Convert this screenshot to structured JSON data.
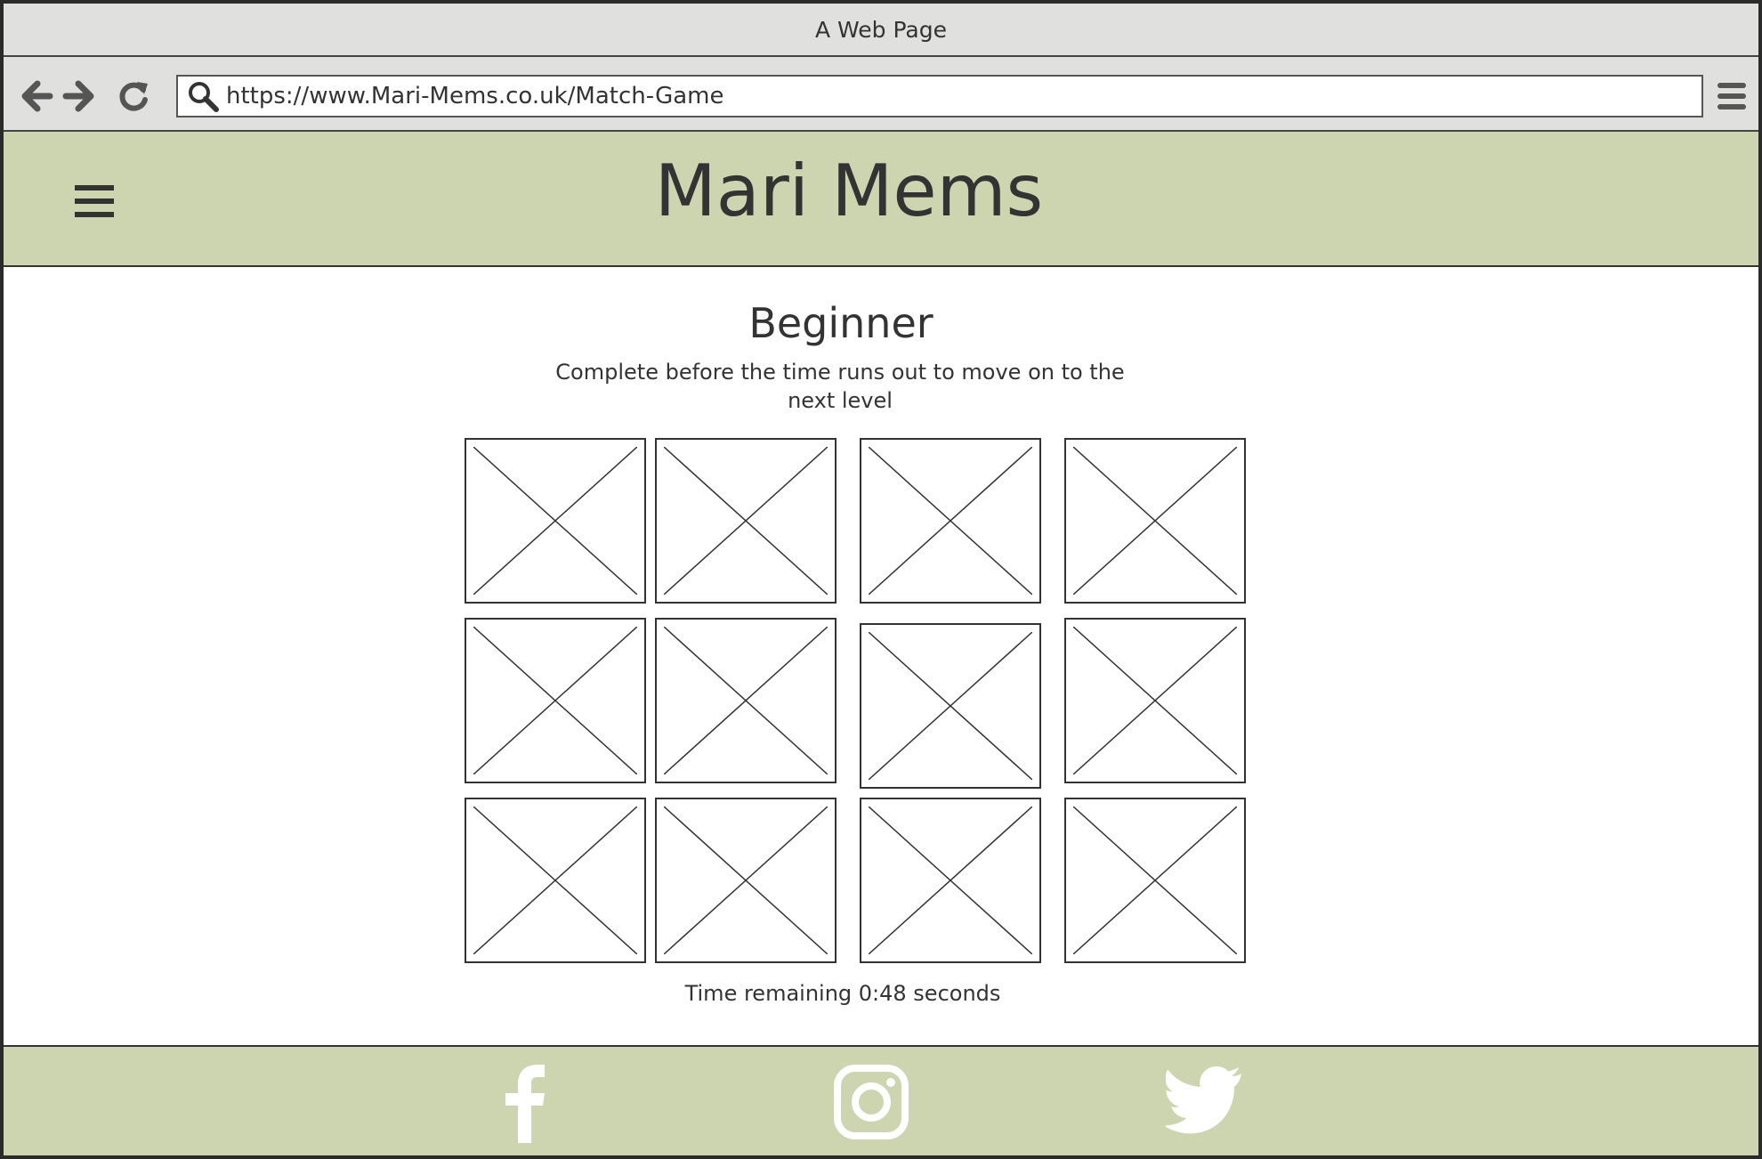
{
  "window": {
    "title": "A Web Page"
  },
  "browser": {
    "url": "https://www.Mari-Mems.co.uk/Match-Game",
    "icons": [
      "back-arrow-icon",
      "forward-arrow-icon",
      "reload-icon",
      "search-icon",
      "browser-menu-icon"
    ]
  },
  "header": {
    "site_title": "Mari Mems",
    "menu_icon": "hamburger-icon"
  },
  "game": {
    "level_title": "Beginner",
    "instructions": "Complete before the time runs out to move on to the next level",
    "card_count": 12,
    "card_state": "face-down image placeholder",
    "timer_text": "Time remaining 0:48 seconds"
  },
  "footer": {
    "social_icons": [
      "facebook-icon",
      "instagram-icon",
      "twitter-icon"
    ]
  },
  "colors": {
    "brand_green": "#cdd5b0",
    "text": "#333333",
    "chrome": "#e0e0df"
  }
}
